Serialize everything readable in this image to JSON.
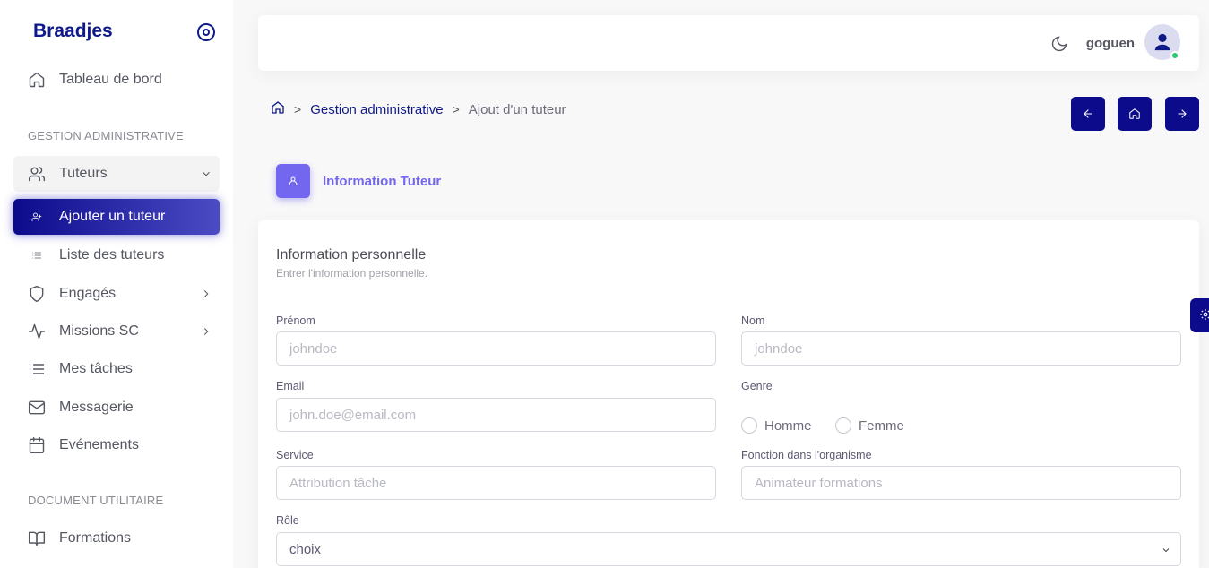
{
  "sidebar": {
    "brand": "Braadjes",
    "items": [
      {
        "label": "Tableau de bord",
        "icon": "home-icon"
      },
      {
        "label": "Tuteurs",
        "icon": "users-icon"
      },
      {
        "label": "Ajouter un tuteur",
        "icon": "user-plus-icon"
      },
      {
        "label": "Liste des tuteurs",
        "icon": "list-icon"
      },
      {
        "label": "Engagés",
        "icon": "shield-icon"
      },
      {
        "label": "Missions SC",
        "icon": "activity-icon"
      },
      {
        "label": "Mes tâches",
        "icon": "list-icon"
      },
      {
        "label": "Messagerie",
        "icon": "mail-icon"
      },
      {
        "label": "Evénements",
        "icon": "calendar-icon"
      },
      {
        "label": "Formations",
        "icon": "book-icon"
      }
    ],
    "sections": {
      "gestion": "GESTION ADMINISTRATIVE",
      "document": "DOCUMENT UTILITAIRE"
    }
  },
  "topbar": {
    "username": "goguen"
  },
  "breadcrumb": {
    "section": "Gestion administrative",
    "current": "Ajout d'un tuteur"
  },
  "step": {
    "title": "Information Tuteur"
  },
  "form": {
    "title": "Information personnelle",
    "subtitle": "Entrer l'information personnelle.",
    "prenom": {
      "label": "Prénom",
      "placeholder": "johndoe"
    },
    "nom": {
      "label": "Nom",
      "placeholder": "johndoe"
    },
    "email": {
      "label": "Email",
      "placeholder": "john.doe@email.com"
    },
    "genre": {
      "label": "Genre",
      "options": [
        "Homme",
        "Femme"
      ]
    },
    "service": {
      "label": "Service",
      "placeholder": "Attribution tâche"
    },
    "fonction": {
      "label": "Fonction dans l'organisme",
      "placeholder": "Animateur formations"
    },
    "role": {
      "label": "Rôle",
      "value": "choix"
    }
  },
  "colors": {
    "primary": "#0c0b8c",
    "accent": "#7367f0",
    "online": "#28c76f"
  }
}
